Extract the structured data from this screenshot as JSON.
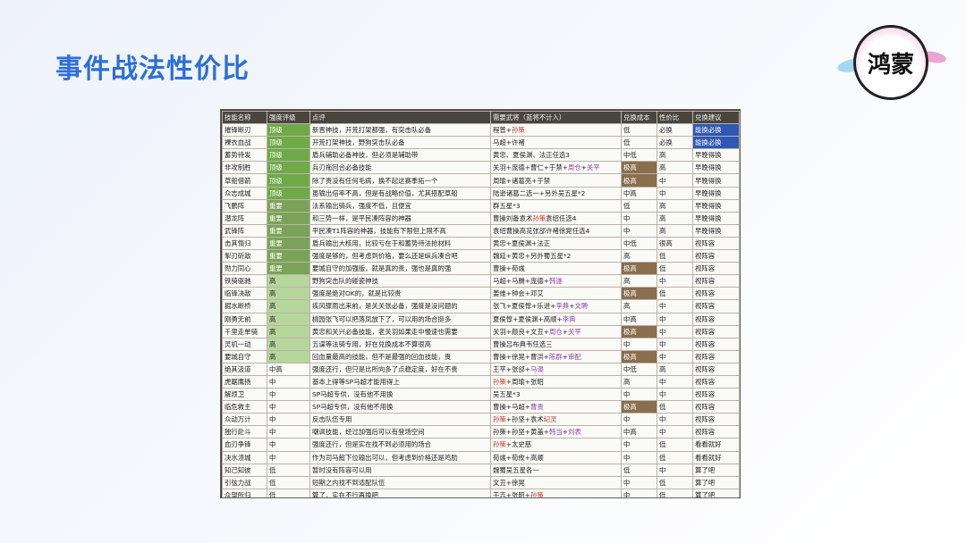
{
  "page_title": "事件战法性价比",
  "logo_text": "鸿蒙",
  "table": {
    "headers": [
      "技能名称",
      "强度评级",
      "点评",
      "需要武将（蓝将不计入）",
      "兑换成本",
      "性价比",
      "兑换建议"
    ],
    "rows": [
      {
        "name": "摧锋断刃",
        "grade": "顶级",
        "comment": "新晋神技，开荒打架都强，有突击队必备",
        "generals": [
          "程普+",
          {
            "t": "孙策",
            "c": "red"
          }
        ],
        "cost": "低",
        "value": "必换",
        "advice": "能换必换"
      },
      {
        "name": "裸衣血战",
        "grade": "顶级",
        "comment": "开荒打架神技，野狗突击队必备",
        "generals": [
          "马超+许褚"
        ],
        "cost": "低",
        "value": "必换",
        "advice": "能换必换"
      },
      {
        "name": "蓄势待发",
        "grade": "顶级",
        "comment": "盾兵辅助必备神技，但必须是辅助带",
        "generals": [
          "黄忠、夏侯渊、法正任选3"
        ],
        "cost": "中低",
        "value": "高",
        "advice": "早晚得换"
      },
      {
        "name": "非攻制胜",
        "grade": "顶级",
        "comment": "兵刃拖回合必备技能",
        "generals": [
          "关羽+庞德+曹仁+于禁+",
          {
            "t": "周仓",
            "c": "purple"
          },
          "+",
          {
            "t": "关平",
            "c": "purple"
          }
        ],
        "cost": "极高",
        "value": "高",
        "advice": "早晚得换"
      },
      {
        "name": "草船借箭",
        "grade": "顶级",
        "comment": "除了贵没有任何毛病，换不起这赛季拓一个",
        "generals": [
          "周瑜+诸葛亮+于禁"
        ],
        "cost": "极高",
        "value": "中",
        "advice": "早晚得换"
      },
      {
        "name": "众志成城",
        "grade": "顶级",
        "comment": "虽输出倍率不高，但是有战略价值，尤其搭配草船",
        "generals": [
          "陆逊诸葛二选一+另外吴五星*2"
        ],
        "cost": "中高",
        "value": "中",
        "advice": "早晚得换"
      },
      {
        "name": "飞鹏阵",
        "grade": "重要",
        "comment": "法系输出骑兵，强度不低，且便宜",
        "generals": [
          "群五星*3"
        ],
        "cost": "低",
        "value": "高",
        "advice": "早晚得换"
      },
      {
        "name": "潜龙阵",
        "grade": "重要",
        "comment": "和三势一样，是平民凑阵容的神器",
        "generals": [
          "曹操刘备袁术",
          {
            "t": "孙策",
            "c": "red"
          },
          "袁绍任选4"
        ],
        "cost": "中",
        "value": "高",
        "advice": "早晚得换"
      },
      {
        "name": "武锋阵",
        "grade": "重要",
        "comment": "平民凑T1阵容的神器，技能有下限但上限不高",
        "generals": [
          "袁绍曹操高览张郃许褚徐晃任选4"
        ],
        "cost": "中",
        "value": "高",
        "advice": "早晚得换"
      },
      {
        "name": "击其惰归",
        "grade": "重要",
        "comment": "盾兵输出大核用，比较亏在于和蓄势待法抢材料",
        "generals": [
          "黄忠+夏侯渊+法正"
        ],
        "cost": "中低",
        "value": "很高",
        "advice": "视阵容"
      },
      {
        "name": "掣刃斫敌",
        "grade": "重要",
        "comment": "强度是够的，但考虑到价格，要么还是纵兵凑合吧",
        "generals": [
          "魏延+黄忠+另外蜀五星*2"
        ],
        "cost": "高",
        "value": "低",
        "advice": "视阵容"
      },
      {
        "name": "勠力同心",
        "grade": "重要",
        "comment": "要城自守的加强版，就是真的贵，强也是真的强",
        "generals": [
          "曹操+荀彧"
        ],
        "cost": "极高",
        "value": "低",
        "advice": "视阵容"
      },
      {
        "name": "铁骑驱驰",
        "grade": "高",
        "comment": "野狗突击队的碰瓷神技",
        "generals": [
          "马超+马腾+庞德+",
          {
            "t": "韩遂",
            "c": "purple"
          }
        ],
        "cost": "高",
        "value": "中",
        "advice": "视阵容"
      },
      {
        "name": "临锋决敌",
        "grade": "高",
        "comment": "强度是绝对OK的，就是比较贵",
        "generals": [
          "姜维+钟会+邓艾"
        ],
        "cost": "极高",
        "value": "低",
        "advice": "视阵容"
      },
      {
        "name": "掘水断桥",
        "grade": "高",
        "comment": "疾风骤雨出来前，是关关张必备，强度是没问题的",
        "generals": [
          "张飞+夏侯惇+乐进+",
          {
            "t": "李典",
            "c": "purple"
          },
          "+",
          {
            "t": "文聘",
            "c": "purple"
          }
        ],
        "cost": "高",
        "value": "中",
        "advice": "视阵容"
      },
      {
        "name": "刚勇无前",
        "grade": "高",
        "comment": "桃园张飞可以把落凤放下了，可以用的场合挺多",
        "generals": [
          "夏侯惇+夏侯渊+高顺+",
          {
            "t": "李典",
            "c": "purple"
          }
        ],
        "cost": "中高",
        "value": "中",
        "advice": "视阵容"
      },
      {
        "name": "千里走单骑",
        "grade": "高",
        "comment": "黄忠和关兴必备技能，老关羽如果走中慢速也需要",
        "generals": [
          "关羽+颜良+文丑+",
          {
            "t": "周仓",
            "c": "purple"
          },
          "+",
          {
            "t": "关平",
            "c": "purple"
          }
        ],
        "cost": "极高",
        "value": "中",
        "advice": "视阵容"
      },
      {
        "name": "灵机一动",
        "grade": "高",
        "comment": "五谋等法骑专用，好在兑换成本不算很高",
        "generals": [
          "曹操吕布典韦任选三"
        ],
        "cost": "中",
        "value": "中",
        "advice": "视阵容"
      },
      {
        "name": "要城自守",
        "grade": "高",
        "comment": "回血量最高的技能，但不是最强的回血技能，贵",
        "generals": [
          "曹操+徐晃+曹洪+",
          {
            "t": "陈群",
            "c": "purple"
          },
          "+",
          {
            "t": "审配",
            "c": "purple"
          }
        ],
        "cost": "极高",
        "value": "中",
        "advice": "视阵容"
      },
      {
        "name": "绝其汲道",
        "grade": "中高",
        "comment": "强度还行，但只是比所向多了点稳定度，好在不贵",
        "generals": [
          "王平+张郃+",
          {
            "t": "马谡",
            "c": "purple"
          }
        ],
        "cost": "中低",
        "value": "高",
        "advice": "视阵容"
      },
      {
        "name": "虎踞鹰扬",
        "grade": "中",
        "comment": "基本上得等SP马超才能用得上",
        "generals": [
          {
            "t": "孙策",
            "c": "red"
          },
          "+周瑜+张昭"
        ],
        "cost": "高",
        "value": "中",
        "advice": "视阵容"
      },
      {
        "name": "解烦卫",
        "grade": "中",
        "comment": "SP马超专供，没有他不用换",
        "generals": [
          "吴五星*3"
        ],
        "cost": "中",
        "value": "中",
        "advice": "视阵容"
      },
      {
        "name": "临危救主",
        "grade": "中",
        "comment": "SP马超专供，没有他不用换",
        "generals": [
          "曹操+马超+",
          {
            "t": "曹贵",
            "c": "purple"
          }
        ],
        "cost": "极高",
        "value": "低",
        "advice": "视阵容"
      },
      {
        "name": "众动万计",
        "grade": "中",
        "comment": "反击队伍专用",
        "generals": [
          {
            "t": "孙策",
            "c": "red"
          },
          "+孙坚+袁术",
          {
            "t": "纪灵",
            "c": "red"
          }
        ],
        "cost": "中",
        "value": "中",
        "advice": "视阵容"
      },
      {
        "name": "独行赴斗",
        "grade": "中",
        "comment": "嘲讽技能，经过加强后可以有登场空间",
        "generals": [
          "孙策+孙坚+黄盖+",
          {
            "t": "韩当",
            "c": "purple"
          },
          "+",
          {
            "t": "刘表",
            "c": "purple"
          }
        ],
        "cost": "中高",
        "value": "中",
        "advice": "视阵容"
      },
      {
        "name": "血刃争锋",
        "grade": "中",
        "comment": "强度还行，但是实在找不到必须用的场合",
        "generals": [
          {
            "t": "孙策",
            "c": "red"
          },
          "+太史慈"
        ],
        "cost": "中",
        "value": "低",
        "advice": "看看就好"
      },
      {
        "name": "决水溃城",
        "grade": "中",
        "comment": "作为司马懿下位输出可以，但考虑到价格还是鸡肋",
        "generals": [
          "荀彧+荀攸+高顺"
        ],
        "cost": "中",
        "value": "低",
        "advice": "看看就好"
      },
      {
        "name": "知己知彼",
        "grade": "低",
        "comment": "暂时没有阵容可以用",
        "generals": [
          "魏蜀吴五星各一"
        ],
        "cost": "低",
        "value": "中",
        "advice": "算了吧"
      },
      {
        "name": "引弦力战",
        "grade": "低",
        "comment": "短期之内找不到适配队伍",
        "generals": [
          "文丑+徐晃"
        ],
        "cost": "中",
        "value": "低",
        "advice": "算了吧"
      },
      {
        "name": "众望所归",
        "grade": "低",
        "comment": "算了，实在不行再换吧",
        "generals": [
          "于吉+张昭+",
          {
            "t": "孙策",
            "c": "red"
          }
        ],
        "cost": "中",
        "value": "低",
        "advice": "算了吧"
      },
      {
        "name": "桃夜掷戟",
        "grade": "低",
        "comment": "混伤技能没有环境，暂时无法登场",
        "generals": [
          "吕布+貂蝉+董卓"
        ],
        "cost": "中高",
        "value": "低",
        "advice": "算了吧"
      },
      {
        "name": "丹阳兵",
        "grade": "低",
        "comment": "很弱，很弱，很弱",
        "generals": [
          "群五星*3"
        ],
        "cost": "中",
        "value": "低",
        "advice": "算了吧"
      }
    ]
  },
  "colors": {
    "title": "#2e6fd8",
    "grade_top": "#6fa948",
    "grade_important": "#7aa357",
    "grade_high": "#b7d69b",
    "cost_high": "#8a6e4e",
    "advice_must": "#2f57b3",
    "header_bg": "#4a453f"
  }
}
